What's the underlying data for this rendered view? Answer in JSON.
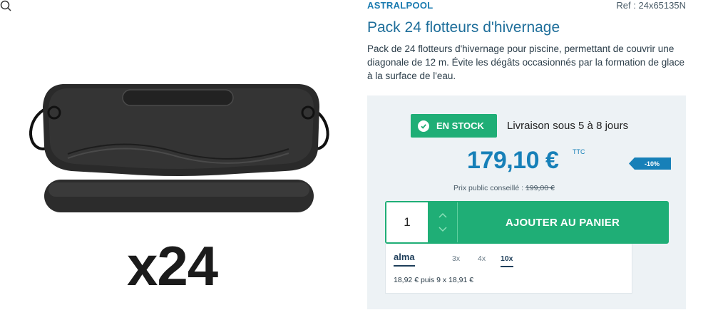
{
  "product": {
    "brand": "ASTRALPOOL",
    "reference": "Ref : 24x65135N",
    "title": "Pack 24 flotteurs d'hivernage",
    "description": "Pack de 24 flotteurs d'hivernage pour piscine, permettant de couvrir une diagonale de 12 m. Évite les dégâts occasionnés par la formation de glace à la surface de l'eau.",
    "image_overlay_text": "x24"
  },
  "buybox": {
    "stock_label": "EN STOCK",
    "delivery_text": "Livraison sous 5 à 8 jours",
    "price": "179,10 €",
    "price_suffix": "TTC",
    "discount_badge": "-10%",
    "public_price_label": "Prix public conseillé :",
    "public_price_value": "199,00 €",
    "quantity": "1",
    "add_to_cart_label": "AJOUTER AU PANIER"
  },
  "alma": {
    "logo": "alma",
    "options": [
      "3x",
      "4x",
      "10x"
    ],
    "selected_option": "10x",
    "detail": "18,92 € puis 9 x 18,91 €"
  },
  "colors": {
    "accent_green": "#1fae76",
    "accent_blue": "#1780b8",
    "title_blue": "#1e6e9a",
    "buybox_bg": "#edf2f5"
  },
  "icons": [
    "check-circle-icon",
    "chevron-up-icon",
    "chevron-down-icon",
    "zoom-icon"
  ]
}
